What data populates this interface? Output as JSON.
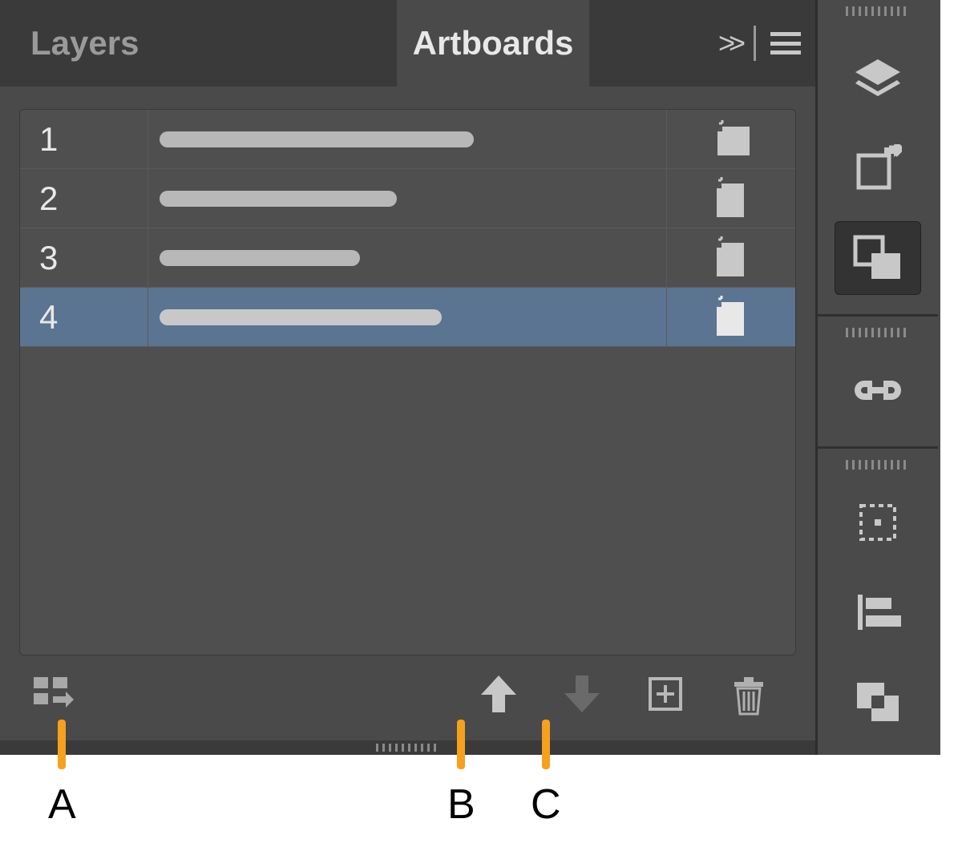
{
  "tabs": {
    "layers_label": "Layers",
    "artboards_label": "Artboards"
  },
  "artboards": {
    "rows": [
      {
        "num": "1",
        "name_bar_width": 392,
        "selected": false
      },
      {
        "num": "2",
        "name_bar_width": 296,
        "selected": false
      },
      {
        "num": "3",
        "name_bar_width": 250,
        "selected": false
      },
      {
        "num": "4",
        "name_bar_width": 352,
        "selected": true
      }
    ]
  },
  "footer": {
    "rearrange": "rearrange-all",
    "move_up": "move-up",
    "move_down": "move-down",
    "new_artboard": "new-artboard",
    "delete": "delete-artboard"
  },
  "callouts": {
    "a": "A",
    "b": "B",
    "c": "C"
  },
  "dock": {
    "layers_icon": "layers",
    "asset_export_icon": "asset-export",
    "artboards_icon": "artboards",
    "links_icon": "links",
    "transform_icon": "transform",
    "align_icon": "align",
    "pathfinder_icon": "pathfinder"
  }
}
